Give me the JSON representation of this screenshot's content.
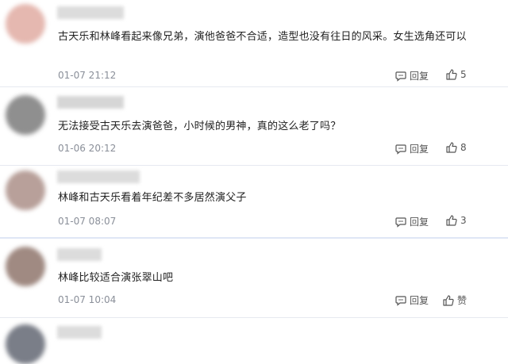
{
  "comments": [
    {
      "avatar_color": "#e5b8b0",
      "text": "古天乐和林峰看起来像兄弟，演他爸爸不合适，造型也没有往日的风采。女生选角还可以",
      "time": "01-07 21:12",
      "reply_label": "回复",
      "likes": "5"
    },
    {
      "avatar_color": "#8f8f8f",
      "text": "无法接受古天乐去演爸爸，小时候的男神，真的这么老了吗？",
      "time": "01-06 20:12",
      "reply_label": "回复",
      "likes": "8"
    },
    {
      "avatar_color": "#b8a09a",
      "text": "林峰和古天乐看着年纪差不多居然演父子",
      "time": "01-07 08:07",
      "reply_label": "回复",
      "likes": "3"
    },
    {
      "avatar_color": "#a08a82",
      "text": "林峰比较适合演张翠山吧",
      "time": "01-07 10:04",
      "reply_label": "回复",
      "likes": "赞"
    },
    {
      "avatar_color": "#7a7e88",
      "text": "",
      "time": "",
      "reply_label": "",
      "likes": ""
    }
  ],
  "icons": {
    "reply": "comment-icon",
    "like": "thumbs-up-icon"
  }
}
